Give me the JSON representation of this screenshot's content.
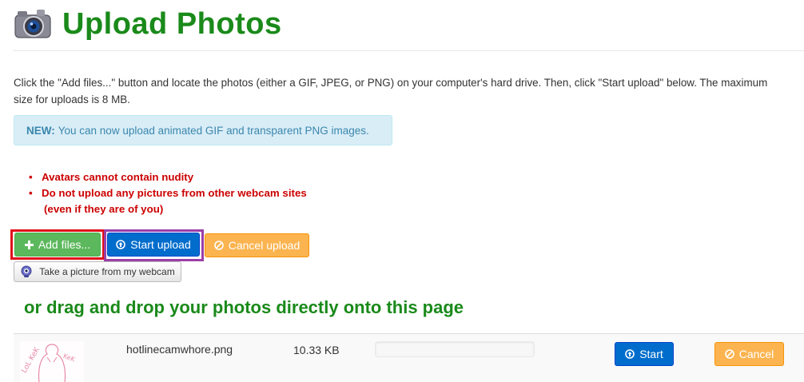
{
  "header": {
    "title": "Upload Photos",
    "icon": "camera-icon"
  },
  "intro": {
    "line1": "Click the \"Add files...\" button and locate the photos (either a GIF, JPEG, or PNG) on your computer's hard drive. Then, click \"Start upload\" below. The maximum",
    "line2": "size for uploads is 8 MB."
  },
  "notice": {
    "label": "NEW:",
    "text": "You can now upload animated GIF and transparent PNG images."
  },
  "rules": {
    "items": [
      "Avatars cannot contain nudity",
      "Do not upload any pictures from other webcam sites"
    ],
    "continuation": "(even if they are of you)"
  },
  "toolbar": {
    "add_label": "Add files...",
    "start_label": "Start upload",
    "cancel_label": "Cancel upload",
    "webcam_label": "Take a picture from my webcam"
  },
  "dropzone": {
    "text": "or drag and drop your photos directly onto this page"
  },
  "files": [
    {
      "name": "hotlinecamwhore.png",
      "size": "10.33 KB",
      "progress": 0,
      "start_label": "Start",
      "cancel_label": "Cancel",
      "thumbnail_text": "LoL KeK"
    }
  ],
  "colors": {
    "title_green": "#1a8a1a",
    "rule_red": "#cc0000",
    "success": "#5cb85c",
    "primary": "#006dcc",
    "warning": "#fbb450",
    "info_bg": "#d9edf7",
    "info_text": "#3a87ad"
  }
}
